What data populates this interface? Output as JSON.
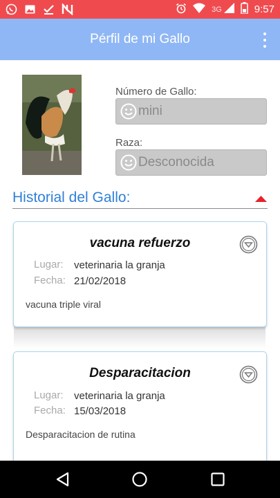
{
  "status_bar": {
    "network": "3G",
    "time": "9:57",
    "color": "#ef4b4f"
  },
  "app_bar": {
    "title": "Pérfil de mi Gallo",
    "color": "#8fb7f5",
    "menu_icon": "more-vert-icon"
  },
  "profile": {
    "photo": "rooster-photo",
    "numero_label": "Número de Gallo:",
    "numero_value": "mini",
    "raza_label": "Raza:",
    "raza_value": "Desconocida"
  },
  "historial": {
    "title": "Historial del Gallo:",
    "accent": "#2f7fd8",
    "lugar_label": "Lugar:",
    "fecha_label": "Fecha:",
    "entries": [
      {
        "title": "vacuna refuerzo",
        "lugar": "veterinaria la granja",
        "fecha": "21/02/2018",
        "descripcion": "vacuna triple viral"
      },
      {
        "title": "Desparacitacion",
        "lugar": "veterinaria la granja",
        "fecha": "15/03/2018",
        "descripcion": "Desparacitacion de rutina"
      }
    ]
  },
  "nav_icons": [
    "back-icon",
    "home-icon",
    "recents-icon"
  ]
}
